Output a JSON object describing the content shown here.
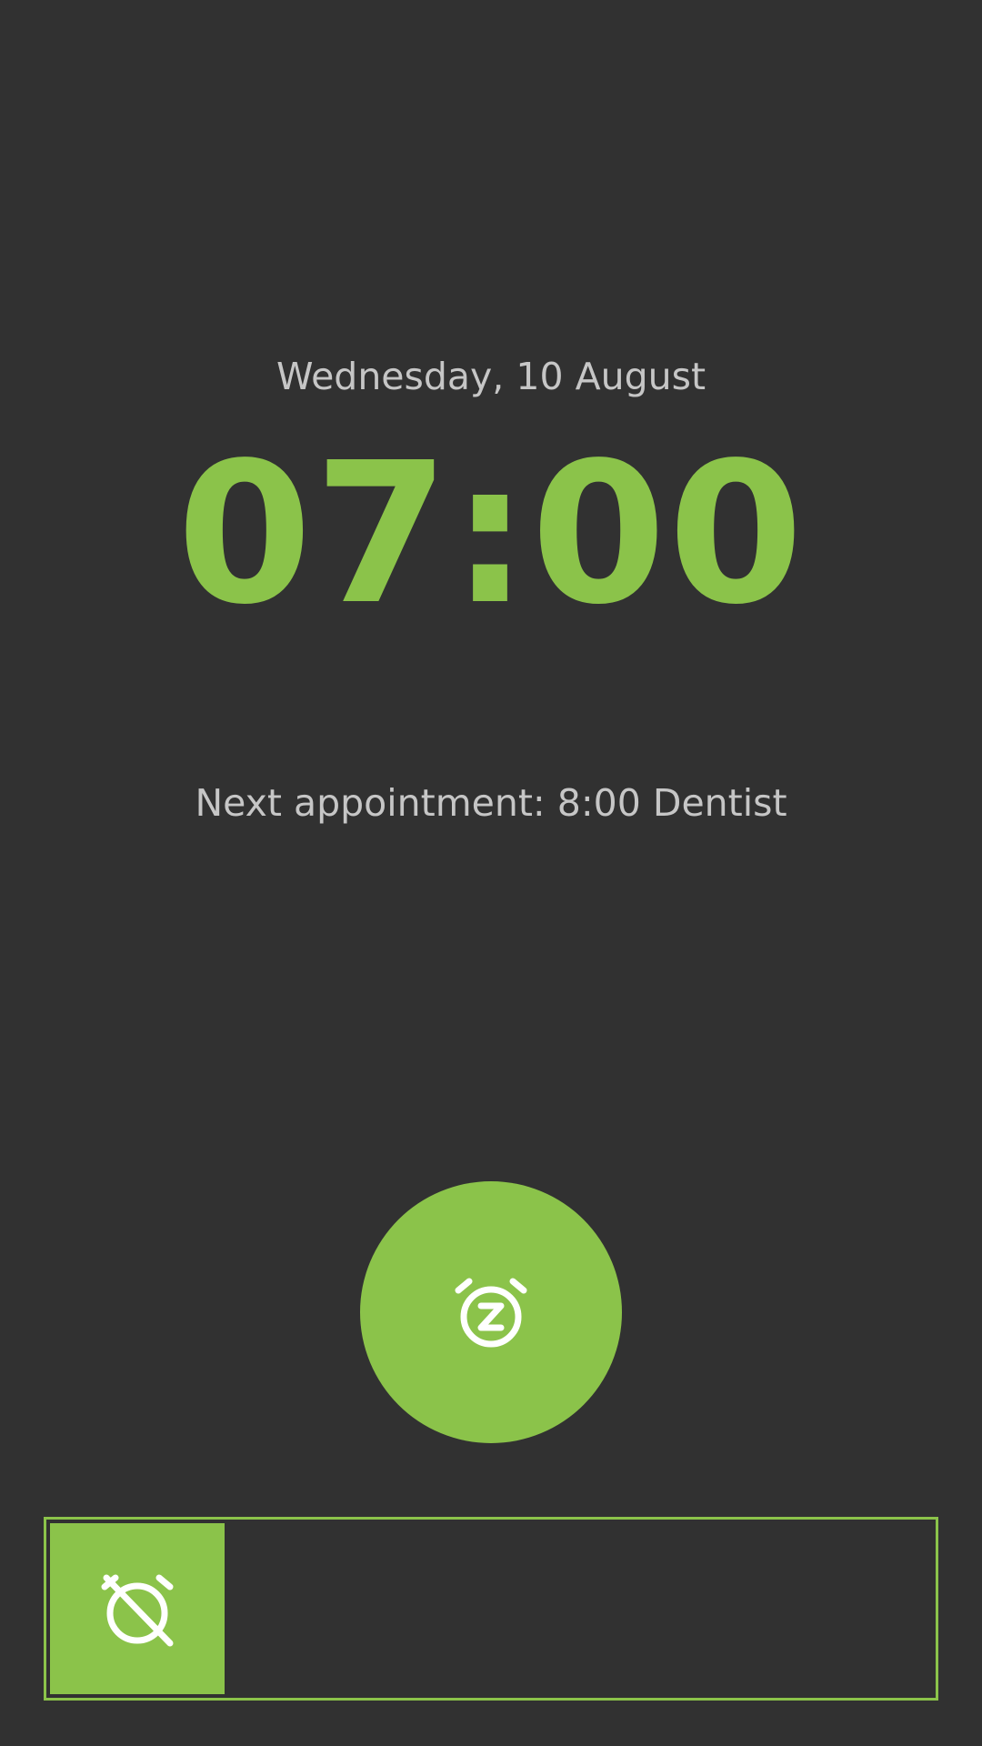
{
  "alarm": {
    "date": "Wednesday, 10 August",
    "time": "07:00",
    "next_appointment": "Next appointment: 8:00 Dentist"
  },
  "controls": {
    "snooze_icon": "snooze-alarm-icon",
    "dismiss_icon": "alarm-off-icon"
  },
  "colors": {
    "background": "#313131",
    "accent": "#8BC34A",
    "secondary_text": "#C6C6C6",
    "icon": "#FFFFFF"
  }
}
